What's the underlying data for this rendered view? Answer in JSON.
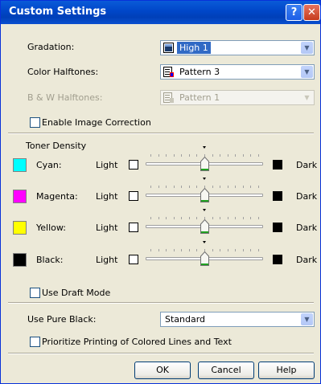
{
  "window": {
    "title": "Custom Settings",
    "help_label": "?",
    "close_label": "✕"
  },
  "gradation": {
    "label": "Gradation:",
    "value": "High 1"
  },
  "color_halftones": {
    "label": "Color Halftones:",
    "value": "Pattern 3"
  },
  "bw_halftones": {
    "label": "B & W Halftones:",
    "value": "Pattern 1"
  },
  "enable_image_correction": {
    "label": "Enable Image Correction",
    "checked": false
  },
  "toner_density": {
    "heading": "Toner Density",
    "light_label": "Light",
    "dark_label": "Dark",
    "channels": [
      {
        "name": "Cyan:",
        "color": "#00ffff",
        "level": 0.5
      },
      {
        "name": "Magenta:",
        "color": "#ff00ff",
        "level": 0.5
      },
      {
        "name": "Yellow:",
        "color": "#ffff00",
        "level": 0.5
      },
      {
        "name": "Black:",
        "color": "#000000",
        "level": 0.5
      }
    ]
  },
  "use_draft_mode": {
    "label": "Use Draft Mode",
    "checked": false
  },
  "use_pure_black": {
    "label": "Use Pure Black:",
    "value": "Standard"
  },
  "prioritize_printing": {
    "label": "Prioritize Printing of Colored Lines and Text",
    "checked": false
  },
  "buttons": {
    "ok": "OK",
    "cancel": "Cancel",
    "help": "Help"
  },
  "icons": {
    "gradation": "gradient-icon",
    "halftones": "pattern-icon"
  },
  "accent_color": "#316ac5"
}
